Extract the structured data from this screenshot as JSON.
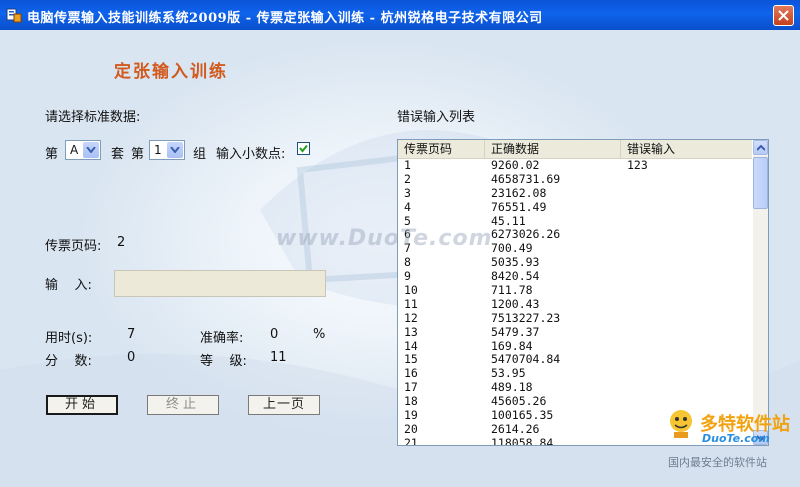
{
  "window": {
    "title": "电脑传票输入技能训练系统2009版 - 传票定张输入训练 - 杭州锐格电子技术有限公司",
    "heading": "定张输入训练"
  },
  "select_section": {
    "label": "请选择标准数据:",
    "set_prefix": "第",
    "set_value": "A",
    "set_suffix": "套",
    "group_prefix": "第",
    "group_value": "1",
    "group_suffix": "组",
    "decimal_label": "输入小数点:",
    "decimal_checked": true
  },
  "ticket": {
    "label": "传票页码:",
    "value": "2"
  },
  "input": {
    "label": "输    入:",
    "value": ""
  },
  "stats": {
    "time_label": "用时(s):",
    "time_value": "7",
    "accuracy_label": "准确率:",
    "accuracy_value": "0",
    "accuracy_unit": "%",
    "score_label": "分    数:",
    "score_value": "0",
    "level_label": "等    级:",
    "level_value": "11"
  },
  "buttons": {
    "start": "开始",
    "stop": "终止",
    "prev": "上一页"
  },
  "error_list": {
    "title": "错误输入列表",
    "columns": [
      "传票页码",
      "正确数据",
      "错误输入"
    ],
    "rows": [
      [
        "1",
        "9260.02",
        "123"
      ],
      [
        "2",
        "4658731.69",
        ""
      ],
      [
        "3",
        "23162.08",
        ""
      ],
      [
        "4",
        "76551.49",
        ""
      ],
      [
        "5",
        "45.11",
        ""
      ],
      [
        "6",
        "6273026.26",
        ""
      ],
      [
        "7",
        "700.49",
        ""
      ],
      [
        "8",
        "5035.93",
        ""
      ],
      [
        "9",
        "8420.54",
        ""
      ],
      [
        "10",
        "711.78",
        ""
      ],
      [
        "11",
        "1200.43",
        ""
      ],
      [
        "12",
        "7513227.23",
        ""
      ],
      [
        "13",
        "5479.37",
        ""
      ],
      [
        "14",
        "169.84",
        ""
      ],
      [
        "15",
        "5470704.84",
        ""
      ],
      [
        "16",
        "53.95",
        ""
      ],
      [
        "17",
        "489.18",
        ""
      ],
      [
        "18",
        "45605.26",
        ""
      ],
      [
        "19",
        "100165.35",
        ""
      ],
      [
        "20",
        "2614.26",
        ""
      ],
      [
        "21",
        "118058.84",
        ""
      ]
    ]
  },
  "watermark": {
    "center": "www.DuoTe.com",
    "brand": "多特软件站",
    "brand_url": "DuoTe.com",
    "slogan": "国内最安全的软件站"
  },
  "colors": {
    "titlebar": "#0a54d8",
    "heading": "#d25a1e",
    "close": "#c3401d"
  }
}
